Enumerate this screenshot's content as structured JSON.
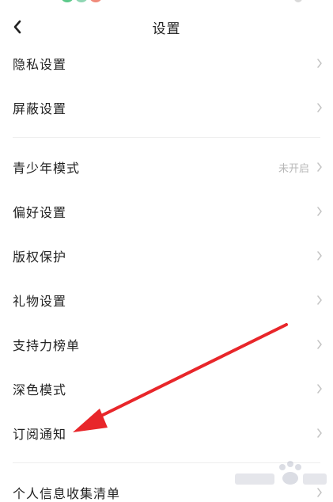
{
  "header": {
    "title": "设置"
  },
  "group1": [
    {
      "label": "隐私设置"
    },
    {
      "label": "屏蔽设置"
    }
  ],
  "group2": [
    {
      "label": "青少年模式",
      "value": "未开启"
    },
    {
      "label": "偏好设置"
    },
    {
      "label": "版权保护"
    },
    {
      "label": "礼物设置"
    },
    {
      "label": "支持力榜单"
    },
    {
      "label": "深色模式"
    },
    {
      "label": "订阅通知"
    }
  ],
  "group3": [
    {
      "label": "个人信息收集清单"
    }
  ],
  "annotation": {
    "arrow_color": "#e8262a",
    "target": "订阅通知"
  },
  "colors": {
    "text": "#222222",
    "secondary": "#b8b8b8",
    "divider": "#eeeeee"
  }
}
